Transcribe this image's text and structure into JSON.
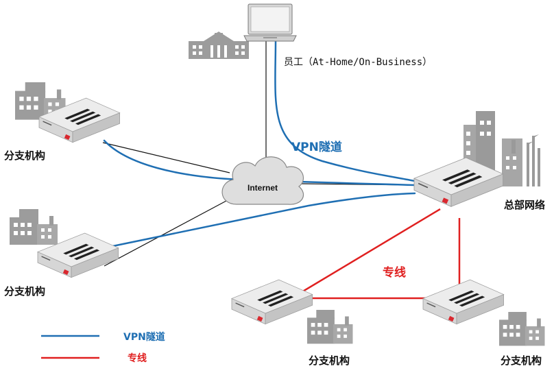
{
  "labels": {
    "branch_top_left": "分支机构",
    "branch_mid_left": "分支机构",
    "branch_bottom_center": "分支机构",
    "branch_bottom_right": "分支机构",
    "headquarters": "总部网络",
    "employee": "员工（At-Home/On-Business）",
    "internet": "Internet",
    "vpn_tunnel": "VPN隧道",
    "leased_line": "专线"
  },
  "legend": {
    "vpn_label": "VPN隧道",
    "leased_label": "专线"
  },
  "colors": {
    "vpn": "#1f6fb3",
    "leased": "#e02020",
    "internet_link": "#111111",
    "device": "#e8e8e8",
    "building": "#9a9a9a",
    "cloud": "#dcdcdc"
  },
  "icons": {
    "device": "firewall-appliance-icon",
    "building": "building-icon",
    "laptop": "laptop-icon",
    "cloud": "internet-cloud-icon"
  }
}
